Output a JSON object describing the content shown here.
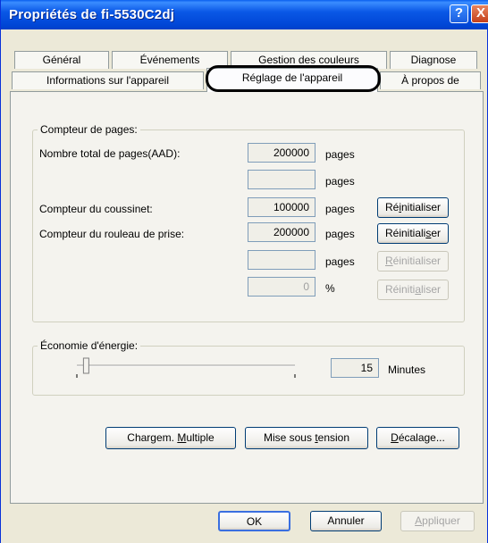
{
  "window": {
    "title": "Propriétés de fi-5530C2dj",
    "help_label": "?",
    "close_label": "X"
  },
  "tabs": {
    "row1": [
      "Général",
      "Événements",
      "Gestion des couleurs",
      "Diagnose"
    ],
    "row2": [
      "Informations sur l'appareil",
      "Réglage de l'appareil",
      "À propos de"
    ],
    "selected": "Réglage de l'appareil"
  },
  "page_counter": {
    "legend": "Compteur de pages:",
    "rows": [
      {
        "label": "Nombre total de pages(AAD):",
        "value": "200000",
        "unit": "pages",
        "button": ""
      },
      {
        "label": "",
        "value": "",
        "unit": "pages",
        "button": ""
      },
      {
        "label": "Compteur du coussinet:",
        "value": "100000",
        "unit": "pages",
        "button_pre": "Ré",
        "button_u": "i",
        "button_post": "nitialiser"
      },
      {
        "label": "Compteur du rouleau de prise:",
        "value": "200000",
        "unit": "pages",
        "button_pre": "Réinitiali",
        "button_u": "s",
        "button_post": "er"
      },
      {
        "label": "",
        "value": "",
        "unit": "pages",
        "button_pre": "",
        "button_u": "R",
        "button_post": "éinitialiser"
      },
      {
        "label": "",
        "value": "0",
        "unit": "%",
        "button_pre": "Réiniti",
        "button_u": "a",
        "button_post": "liser"
      }
    ]
  },
  "energy": {
    "legend": "Économie d'énergie:",
    "value": "15",
    "unit": "Minutes",
    "slider_min": 5,
    "slider_max": 240,
    "slider_value": 15
  },
  "actions": {
    "multi_pre": "Chargem. ",
    "multi_u": "M",
    "multi_post": "ultiple",
    "power_pre": "Mise sous ",
    "power_u": "t",
    "power_post": "ension",
    "offset_pre": "",
    "offset_u": "D",
    "offset_post": "écalage..."
  },
  "footer": {
    "ok": "OK",
    "cancel": "Annuler",
    "apply_pre": "",
    "apply_u": "A",
    "apply_post": "ppliquer"
  }
}
